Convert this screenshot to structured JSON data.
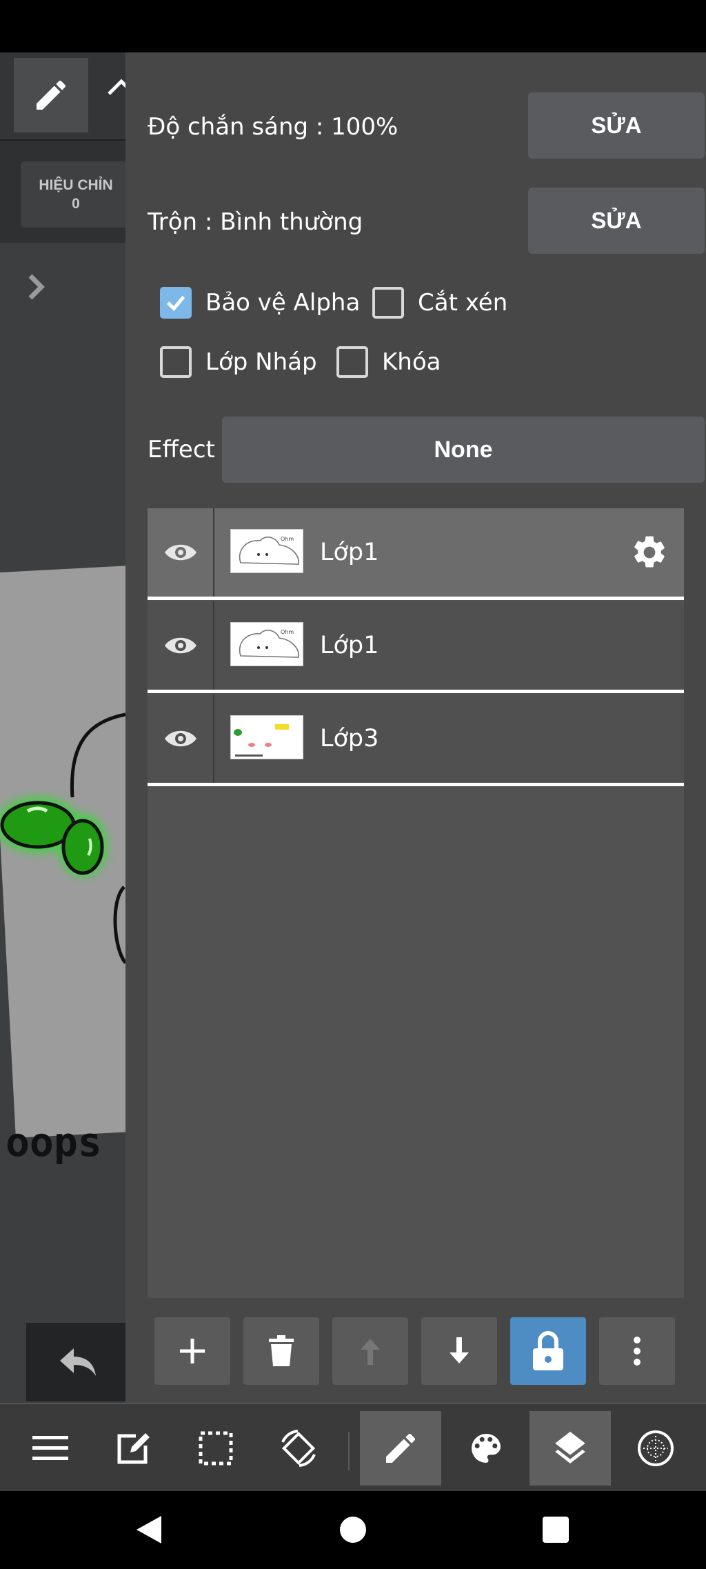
{
  "left_panel": {
    "adjust_label": "HIỆU CHỈN",
    "adjust_value": "0",
    "canvas_text": "oops"
  },
  "layer_panel": {
    "opacity_label": "Độ chắn sáng : 100%",
    "opacity_edit": "SỬA",
    "blend_label": "Trộn : Bình thường",
    "blend_edit": "SỬA",
    "protect_alpha": {
      "label": "Bảo vệ Alpha",
      "checked": true
    },
    "clipping": {
      "label": "Cắt xén",
      "checked": false
    },
    "draft_layer": {
      "label": "Lớp Nháp",
      "checked": false
    },
    "lock": {
      "label": "Khóa",
      "checked": false
    },
    "effect_label": "Effect",
    "effect_value": "None",
    "layers": [
      {
        "name": "Lớp1",
        "visible": true,
        "selected": true
      },
      {
        "name": "Lớp1",
        "visible": true,
        "selected": false
      },
      {
        "name": "Lớp3",
        "visible": true,
        "selected": false
      }
    ],
    "actions": [
      "add-icon",
      "delete-icon",
      "move-up-icon",
      "move-down-icon",
      "lock-icon",
      "more-icon"
    ]
  },
  "toolbar": {
    "items": [
      "menu-icon",
      "edit-icon",
      "selection-icon",
      "rotate-icon",
      "pencil-icon",
      "palette-icon",
      "layers-icon",
      "globe-icon"
    ],
    "selected": [
      "pencil-icon",
      "layers-icon"
    ]
  },
  "colors": {
    "panel_bg": "#474747",
    "button_bg": "#595b5e",
    "check_accent": "#7eb8e8",
    "lock_active": "#4e8dc4"
  }
}
